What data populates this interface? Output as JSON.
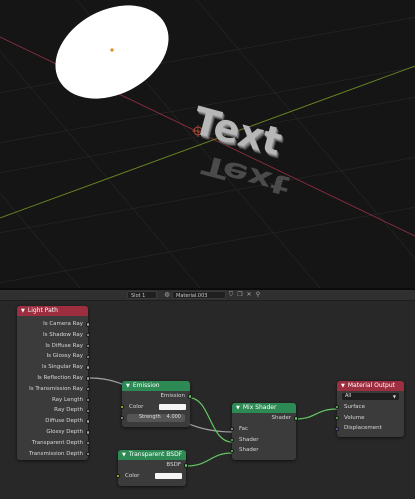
{
  "viewport": {
    "text_object": "Text"
  },
  "header": {
    "slot": "Slot 1",
    "material": "Material.003",
    "icons": [
      "sphere-icon",
      "shield-icon",
      "copy-icon",
      "delete-icon",
      "pin-icon"
    ]
  },
  "nodes": {
    "light_path": {
      "title": "Light Path",
      "color": "#9c2e40",
      "outputs": [
        "Is Camera Ray",
        "Is Shadow Ray",
        "Is Diffuse Ray",
        "Is Glossy Ray",
        "Is Singular Ray",
        "Is Reflection Ray",
        "Is Transmission Ray",
        "Ray Length",
        "Ray Depth",
        "Diffuse Depth",
        "Glossy Depth",
        "Transparent Depth",
        "Transmission Depth"
      ]
    },
    "emission": {
      "title": "Emission",
      "color": "#2d8a54",
      "output": "Emission",
      "color_label": "Color",
      "strength_label": "Strength",
      "strength_value": "4.000"
    },
    "transparent_bsdf": {
      "title": "Transparent BSDF",
      "color": "#2d8a54",
      "output": "BSDF",
      "color_label": "Color"
    },
    "mix_shader": {
      "title": "Mix Shader",
      "color": "#2d8a54",
      "output": "Shader",
      "inputs": [
        "Fac",
        "Shader",
        "Shader"
      ]
    },
    "material_output": {
      "title": "Material Output",
      "color": "#9c2e40",
      "target": "All",
      "inputs": [
        "Surface",
        "Volume",
        "Displacement"
      ]
    }
  }
}
